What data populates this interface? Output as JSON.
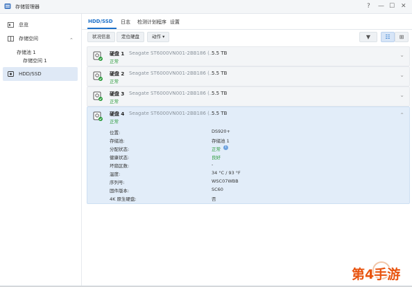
{
  "window": {
    "title": "存储管理器"
  },
  "window_controls": {
    "help": "?",
    "minimize": "—",
    "maximize": "☐",
    "close": "✕"
  },
  "sidebar": {
    "items": [
      {
        "label": "总览"
      },
      {
        "label": "存储空间",
        "expand": "⌃"
      },
      {
        "label": "存储池 1"
      },
      {
        "label": "存储空间 1"
      },
      {
        "label": "HDD/SSD"
      }
    ]
  },
  "tabs": [
    {
      "label": "HDD/SSD"
    },
    {
      "label": "日志"
    },
    {
      "label": "检测计划程序"
    },
    {
      "label": "设置"
    }
  ],
  "toolbar": {
    "status_info": "状况信息",
    "locate_disk": "定位硬盘",
    "action": "动作 ▾",
    "filter": "▼",
    "list_view": "☷",
    "grid_view": "⊞"
  },
  "disks": [
    {
      "name": "硬盘 1",
      "model": "Seagate ST6000VN001-2BB186 (...",
      "size": "5.5 TB",
      "status": "正常",
      "chevron": "⌄"
    },
    {
      "name": "硬盘 2",
      "model": "Seagate ST6000VN001-2BB186 (...",
      "size": "5.5 TB",
      "status": "正常",
      "chevron": "⌄"
    },
    {
      "name": "硬盘 3",
      "model": "Seagate ST6000VN001-2BB186 (...",
      "size": "5.5 TB",
      "status": "正常",
      "chevron": "⌄"
    },
    {
      "name": "硬盘 4",
      "model": "Seagate ST6000VN001-2BB186 (...",
      "size": "5.5 TB",
      "status": "正常",
      "chevron": "⌃"
    }
  ],
  "details": [
    {
      "label": "位置:",
      "value": "DS920+"
    },
    {
      "label": "存储池:",
      "value": "存储池 1"
    },
    {
      "label": "分配状态:",
      "value": "正常"
    },
    {
      "label": "健康状态:",
      "value": "良好"
    },
    {
      "label": "坏扇区数:",
      "value": "-"
    },
    {
      "label": "温度:",
      "value": "34 °C / 93 °F"
    },
    {
      "label": "序列号:",
      "value": "WSC07WBB"
    },
    {
      "label": "固件版本:",
      "value": "SC60"
    },
    {
      "label": "4K 原生硬盘:",
      "value": "否"
    }
  ],
  "info_mark": "i",
  "watermark": "第4手游",
  "colors": {
    "accent": "#1a6fc9",
    "ok": "#2a9a3a",
    "selected_row": "#e2edf9"
  }
}
